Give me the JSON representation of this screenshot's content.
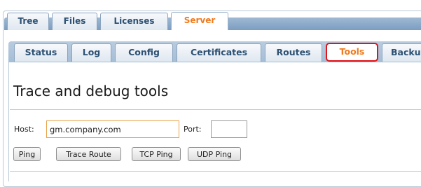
{
  "top_tabs": [
    {
      "label": "Tree",
      "active": false
    },
    {
      "label": "Files",
      "active": false
    },
    {
      "label": "Licenses",
      "active": false
    },
    {
      "label": "Server",
      "active": true
    }
  ],
  "sub_tabs": [
    {
      "label": "Status",
      "active": false
    },
    {
      "label": "Log",
      "active": false
    },
    {
      "label": "Config",
      "active": false
    },
    {
      "label": "Certificates",
      "active": false
    },
    {
      "label": "Routes",
      "active": false
    },
    {
      "label": "Tools",
      "active": true
    },
    {
      "label": "Backu",
      "active": false
    }
  ],
  "page": {
    "title": "Trace and debug tools"
  },
  "form": {
    "host_label": "Host:",
    "host_value": "gm.company.com",
    "port_label": "Port:",
    "port_value": ""
  },
  "buttons": {
    "ping": "Ping",
    "trace_route": "Trace Route",
    "tcp_ping": "TCP Ping",
    "udp_ping": "UDP Ping"
  },
  "colors": {
    "active_tab_text": "#f07a1c",
    "tab_text": "#2d5173",
    "highlight_border": "#e0141a",
    "host_input_border": "#e8a24a"
  }
}
